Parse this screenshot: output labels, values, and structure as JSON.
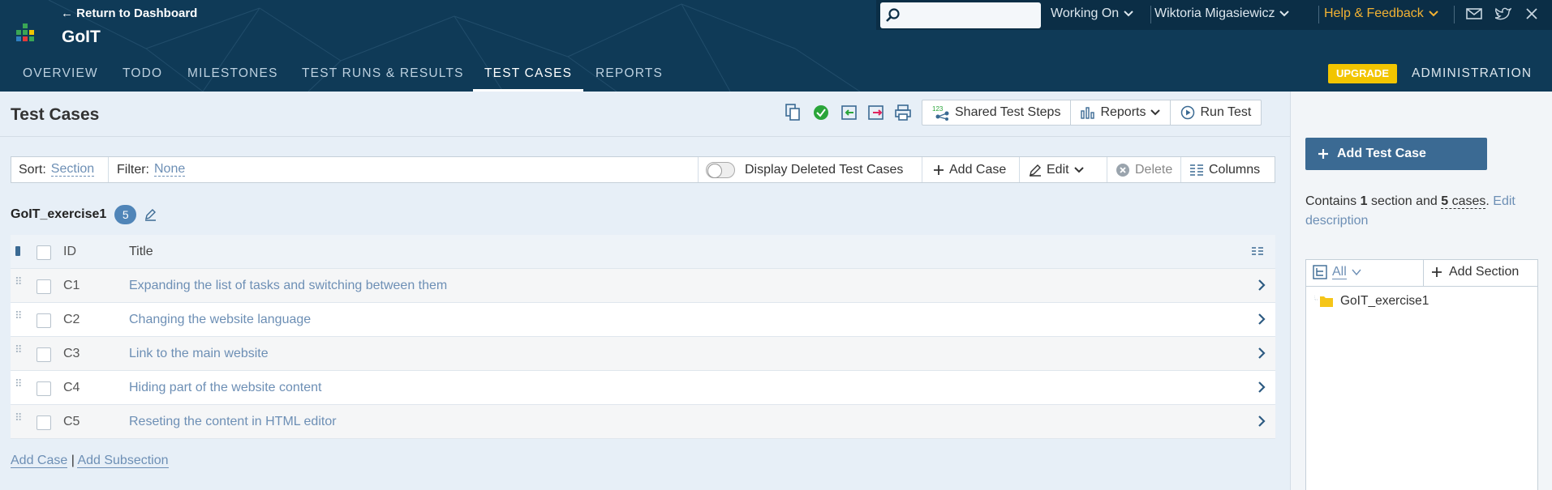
{
  "header": {
    "back_link": "← Return to Dashboard",
    "project_title": "GoIT",
    "nav_tabs": [
      {
        "label": "OVERVIEW"
      },
      {
        "label": "TODO"
      },
      {
        "label": "MILESTONES"
      },
      {
        "label": "TEST RUNS & RESULTS"
      },
      {
        "label": "TEST CASES",
        "active": true
      },
      {
        "label": "REPORTS"
      }
    ],
    "search_placeholder": "",
    "working_on": "Working On",
    "user_name": "Wiktoria Migasiewicz",
    "help": "Help & Feedback",
    "upgrade": "UPGRADE",
    "administration": "ADMINISTRATION",
    "colors": {
      "header_bg": "#0f3a57",
      "accent": "#f2c500",
      "help": "#f2b233"
    }
  },
  "page": {
    "title": "Test Cases",
    "icons": [
      "copy-icon",
      "sync-icon",
      "import-icon",
      "export-icon",
      "print-icon"
    ],
    "buttons": {
      "shared_steps": "Shared Test Steps",
      "reports": "Reports",
      "run_test": "Run Test"
    }
  },
  "toolbar": {
    "sort_label": "Sort:",
    "sort_value": "Section",
    "filter_label": "Filter:",
    "filter_value": "None",
    "display_deleted": "Display Deleted Test Cases",
    "add_case": "Add Case",
    "edit": "Edit",
    "delete": "Delete",
    "columns": "Columns"
  },
  "section": {
    "name": "GoIT_exercise1",
    "count": "5"
  },
  "table": {
    "col_id": "ID",
    "col_title": "Title",
    "rows": [
      {
        "id": "C1",
        "title": "Expanding the list of tasks and switching between them"
      },
      {
        "id": "C2",
        "title": "Changing the website language"
      },
      {
        "id": "C3",
        "title": "Link to the main website"
      },
      {
        "id": "C4",
        "title": "Hiding part of the website content"
      },
      {
        "id": "C5",
        "title": "Reseting the content in HTML editor"
      }
    ]
  },
  "bottom": {
    "add_case": "Add Case",
    "separator": "|",
    "add_subsection": "Add Subsection"
  },
  "sidebar": {
    "add_test_case": "Add Test Case",
    "contains_prefix": "Contains ",
    "sections_count": "1",
    "sections_word": " section and ",
    "cases": "5 cases",
    "cases_count": "5",
    "cases_word": " cases",
    "period": ". ",
    "edit_description": "Edit description",
    "tree_filter": "All",
    "add_section": "Add Section",
    "tree_node": "GoIT_exercise1"
  }
}
